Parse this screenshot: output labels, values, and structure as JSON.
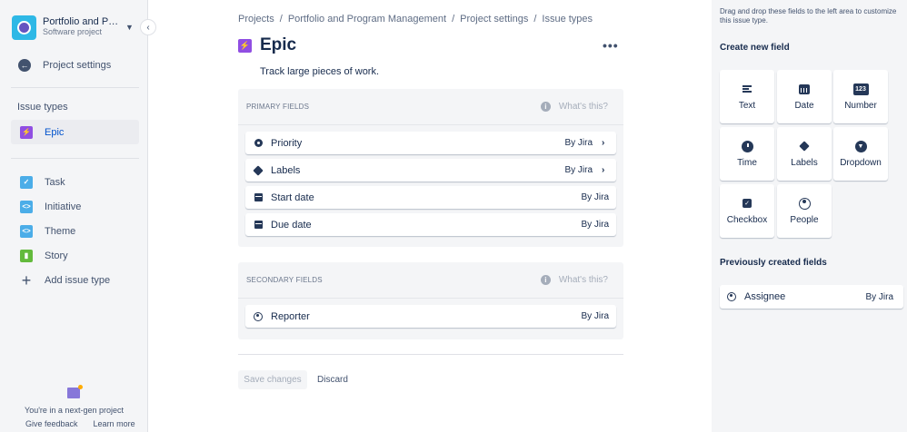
{
  "sidebar": {
    "project_name": "Portfolio and Pro...",
    "project_type": "Software project",
    "settings_label": "Project settings",
    "section_title": "Issue types",
    "active_item": "Epic",
    "items": [
      {
        "label": "Task",
        "icon": "task-icon"
      },
      {
        "label": "Initiative",
        "icon": "initiative-icon"
      },
      {
        "label": "Theme",
        "icon": "theme-icon"
      },
      {
        "label": "Story",
        "icon": "story-icon"
      }
    ],
    "add_label": "Add issue type",
    "footer_text": "You're in a next-gen project",
    "feedback_link": "Give feedback",
    "learn_more_link": "Learn more"
  },
  "breadcrumb": [
    "Projects",
    "Portfolio and Program Management",
    "Project settings",
    "Issue types"
  ],
  "page": {
    "title": "Epic",
    "description": "Track large pieces of work."
  },
  "primary": {
    "title": "PRIMARY FIELDS",
    "whats_this": "What's this?",
    "fields": [
      {
        "label": "Priority",
        "by": "By Jira",
        "icon": "priority-icon",
        "expandable": true
      },
      {
        "label": "Labels",
        "by": "By Jira",
        "icon": "label-icon",
        "expandable": true
      },
      {
        "label": "Start date",
        "by": "By Jira",
        "icon": "calendar-icon",
        "expandable": false
      },
      {
        "label": "Due date",
        "by": "By Jira",
        "icon": "calendar-icon",
        "expandable": false
      }
    ]
  },
  "secondary": {
    "title": "SECONDARY FIELDS",
    "whats_this": "What's this?",
    "fields": [
      {
        "label": "Reporter",
        "by": "By Jira",
        "icon": "person-icon",
        "expandable": false
      }
    ]
  },
  "actions": {
    "save": "Save changes",
    "discard": "Discard"
  },
  "right_panel": {
    "hint": "Drag and drop these fields to the left area to customize this issue type.",
    "create_title": "Create new field",
    "tiles": [
      {
        "label": "Text",
        "icon": "text-icon"
      },
      {
        "label": "Date",
        "icon": "calendar-icon"
      },
      {
        "label": "Number",
        "icon": "number-icon",
        "glyph": "123"
      },
      {
        "label": "Time",
        "icon": "clock-icon"
      },
      {
        "label": "Labels",
        "icon": "label-icon"
      },
      {
        "label": "Dropdown",
        "icon": "dropdown-icon"
      },
      {
        "label": "Checkbox",
        "icon": "checkbox-icon"
      },
      {
        "label": "People",
        "icon": "people-icon"
      }
    ],
    "previous_title": "Previously created fields",
    "previous": [
      {
        "label": "Assignee",
        "by": "By Jira",
        "icon": "person-icon"
      }
    ]
  },
  "colors": {
    "epic": "#904EE2",
    "task": "#4BADE8",
    "story": "#63BA3C",
    "link_active": "#0052CC"
  }
}
